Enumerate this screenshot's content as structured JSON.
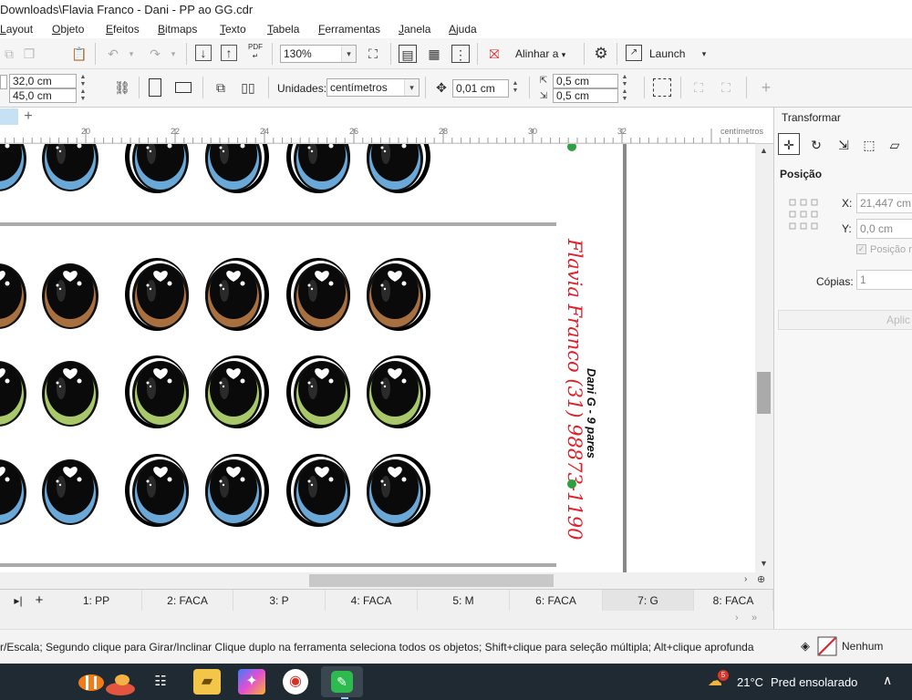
{
  "window": {
    "title": "Downloads\\Flavia Franco - Dani - PP ao GG.cdr"
  },
  "menu": [
    "Layout",
    "Objeto",
    "Efeitos",
    "Bitmaps",
    "Texto",
    "Tabela",
    "Ferramentas",
    "Janela",
    "Ajuda"
  ],
  "toolbar1": {
    "zoom": "130%",
    "align_label": "Alinhar a",
    "launch_label": "Launch",
    "pdf_label": "PDF"
  },
  "toolbar2": {
    "width_value": "32,0 cm",
    "height_value": "45,0 cm",
    "units_label": "Unidades:",
    "units_value": "centímetros",
    "nudge_value": "0,01 cm",
    "dup_x": "0,5 cm",
    "dup_y": "0,5 cm"
  },
  "ruler": {
    "ticks": [
      "20",
      "22",
      "24",
      "26",
      "28",
      "30",
      "32"
    ],
    "units": "centímetros"
  },
  "canvas": {
    "vertical_text_red": "Flavia Franco (31) 98873-1190",
    "vertical_text_black": "Dani G - 9 pares",
    "rows": [
      {
        "iris_color": "#6aa8d8",
        "label": "blue"
      },
      {
        "iris_color": "#a9703f",
        "label": "brown"
      },
      {
        "iris_color": "#a8c86a",
        "label": "green"
      },
      {
        "iris_color": "#6aa8d8",
        "label": "blue"
      }
    ]
  },
  "page_tabs": [
    "1: PP",
    "2: FACA",
    "3: P",
    "4: FACA",
    "5: M",
    "6: FACA",
    "7: G",
    "8: FACA"
  ],
  "active_tab_index": 6,
  "docker": {
    "title": "Transformar",
    "section": "Posição",
    "x_label": "X:",
    "x_value": "21,447 cm",
    "y_label": "Y:",
    "y_value": "0,0 cm",
    "relative_label": "Posição r",
    "copies_label": "Cópias:",
    "copies_value": "1",
    "apply_label": "Aplic"
  },
  "status": {
    "hint": "r/Escala; Segundo clique para Girar/Inclinar Clique duplo na ferramenta seleciona todos os objetos; Shift+clique para seleção múltipla; Alt+clique aprofunda",
    "fill_label": "Nenhum"
  },
  "taskbar": {
    "weather_temp": "21°C",
    "weather_desc": "Pred ensolarado",
    "badge": "5"
  },
  "colors": {
    "accent_red": "#e0202a",
    "taskbar": "#1f2a33",
    "active_tab": "#e4e4e4"
  }
}
